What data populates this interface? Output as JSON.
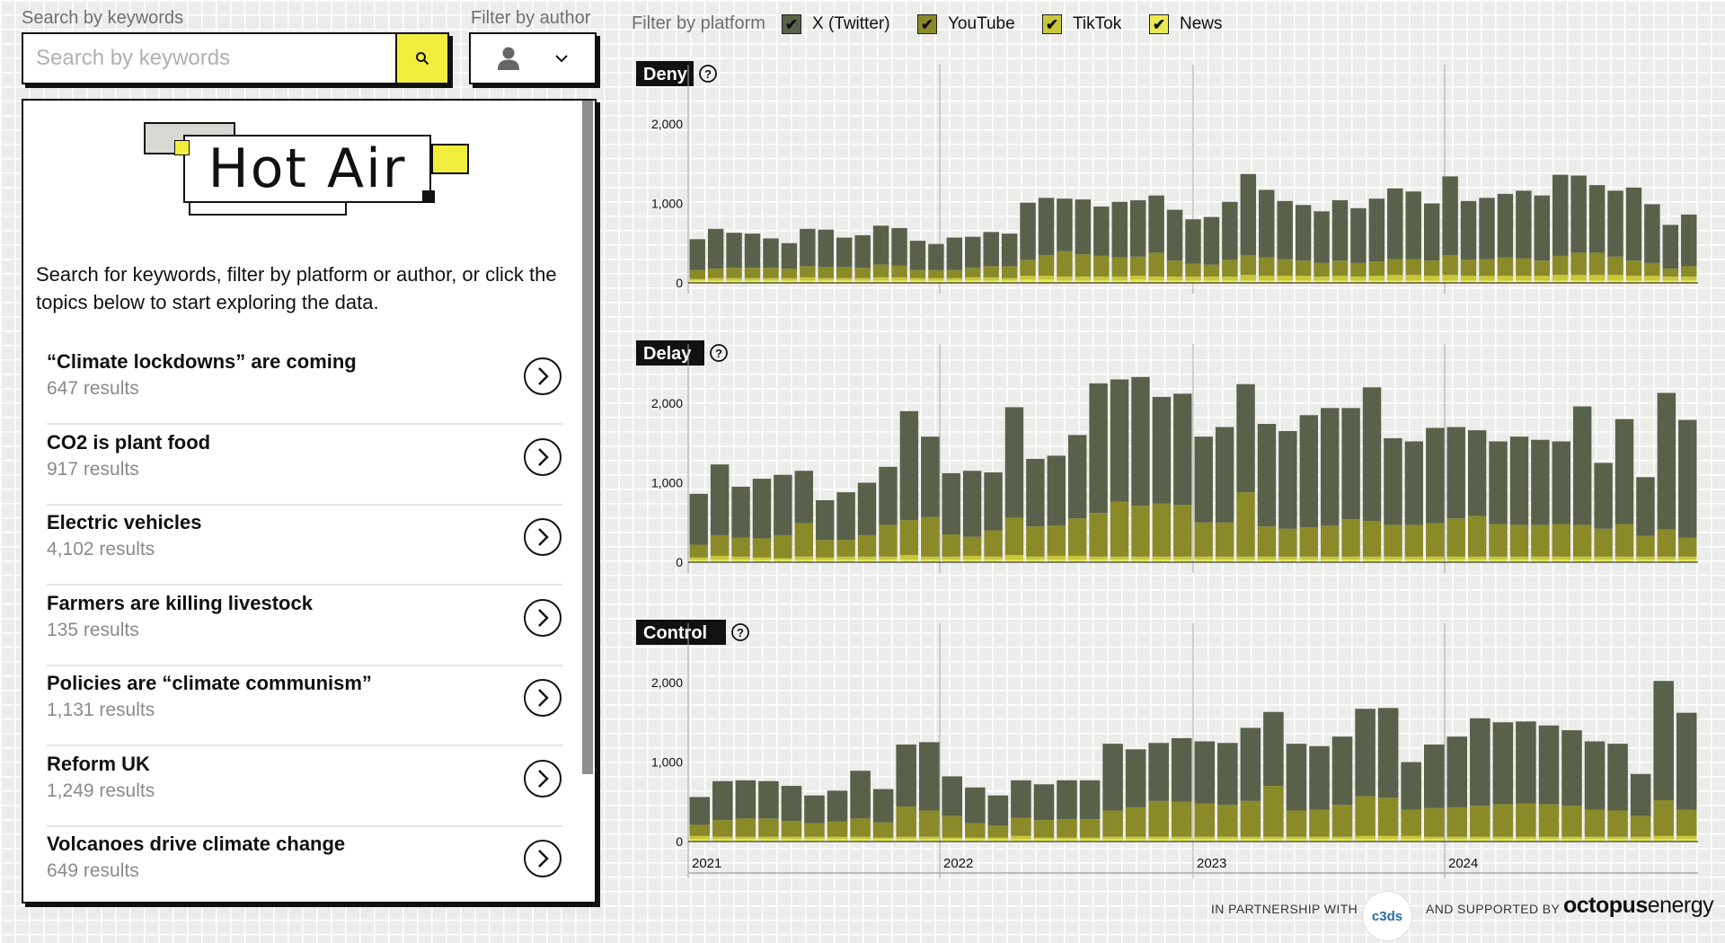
{
  "search": {
    "label": "Search by keywords",
    "placeholder": "Search by keywords"
  },
  "author_filter": {
    "label": "Filter by author"
  },
  "platform_filter": {
    "label": "Filter by platform",
    "options": [
      {
        "label": "X (Twitter)",
        "checked": true,
        "color": "#59614a"
      },
      {
        "label": "YouTube",
        "checked": true,
        "color": "#8a8a29"
      },
      {
        "label": "TikTok",
        "checked": true,
        "color": "#c9c73a"
      },
      {
        "label": "News",
        "checked": true,
        "color": "#ebea55"
      }
    ]
  },
  "logo": {
    "text": "Hot Air"
  },
  "intro": "Search for keywords, filter by platform or author, or click the topics below to start exploring the data.",
  "topics": [
    {
      "title": "“Climate lockdowns” are coming",
      "count": "647 results"
    },
    {
      "title": "CO2 is plant food",
      "count": "917 results"
    },
    {
      "title": "Electric vehicles",
      "count": "4,102 results"
    },
    {
      "title": "Farmers are killing livestock",
      "count": "135 results"
    },
    {
      "title": "Policies are “climate communism”",
      "count": "1,131 results"
    },
    {
      "title": "Reform UK",
      "count": "1,249 results"
    },
    {
      "title": "Volcanoes drive climate change",
      "count": "649 results"
    }
  ],
  "footer": {
    "partnership": "IN PARTNERSHIP WITH",
    "supported": "AND SUPPORTED BY",
    "partner_logo": "c3ds",
    "sponsor": "octopus",
    "sponsor_suffix": "energy"
  },
  "chart_data": {
    "type": "bar",
    "stacked": true,
    "x_ticks": [
      "2021",
      "2022",
      "2023",
      "2024"
    ],
    "x_start": "2021-01",
    "y_ticks": [
      "0",
      "1,000",
      "2,000"
    ],
    "ylim": [
      0,
      2400
    ],
    "series_colors": {
      "X (Twitter)": "#59614a",
      "YouTube": "#8a8a29",
      "TikTok": "#c9c73a",
      "News": "#ebea55"
    },
    "charts": [
      {
        "title": "Deny",
        "total": [
          550,
          680,
          630,
          620,
          560,
          500,
          680,
          670,
          570,
          600,
          720,
          690,
          530,
          490,
          570,
          580,
          640,
          620,
          1010,
          1070,
          1060,
          1050,
          960,
          1020,
          1040,
          1100,
          920,
          800,
          830,
          1020,
          1370,
          1170,
          1030,
          980,
          900,
          1040,
          940,
          1060,
          1190,
          1150,
          1000,
          1340,
          1030,
          1070,
          1120,
          1160,
          1100,
          1360,
          1350,
          1230,
          1160,
          1200,
          990,
          730,
          860
        ],
        "x_twitter": [
          390,
          500,
          440,
          430,
          370,
          320,
          470,
          470,
          370,
          410,
          490,
          470,
          370,
          330,
          410,
          390,
          430,
          410,
          720,
          720,
          660,
          690,
          620,
          700,
          710,
          720,
          640,
          560,
          600,
          730,
          1020,
          850,
          730,
          700,
          650,
          760,
          690,
          790,
          890,
          850,
          720,
          990,
          740,
          770,
          800,
          850,
          820,
          1020,
          970,
          850,
          830,
          920,
          740,
          550,
          650
        ],
        "youtube": [
          110,
          120,
          130,
          130,
          130,
          120,
          140,
          140,
          140,
          130,
          160,
          150,
          100,
          100,
          100,
          120,
          140,
          150,
          200,
          260,
          320,
          280,
          260,
          240,
          240,
          300,
          200,
          160,
          150,
          210,
          250,
          230,
          210,
          190,
          170,
          190,
          170,
          180,
          200,
          200,
          190,
          250,
          200,
          210,
          230,
          220,
          190,
          240,
          280,
          280,
          230,
          190,
          160,
          100,
          130
        ],
        "tiktok": [
          20,
          30,
          30,
          30,
          30,
          30,
          40,
          30,
          30,
          30,
          40,
          40,
          30,
          30,
          30,
          40,
          40,
          30,
          50,
          50,
          50,
          50,
          50,
          50,
          50,
          50,
          50,
          50,
          50,
          50,
          70,
          60,
          60,
          60,
          50,
          60,
          50,
          60,
          70,
          70,
          60,
          70,
          60,
          60,
          60,
          60,
          60,
          70,
          70,
          70,
          70,
          60,
          60,
          50,
          50
        ],
        "news": [
          30,
          30,
          30,
          30,
          30,
          30,
          30,
          30,
          30,
          30,
          30,
          30,
          30,
          30,
          30,
          30,
          30,
          30,
          40,
          40,
          30,
          30,
          30,
          30,
          40,
          30,
          30,
          30,
          30,
          30,
          30,
          30,
          30,
          30,
          30,
          30,
          30,
          30,
          30,
          30,
          30,
          30,
          30,
          30,
          30,
          30,
          30,
          30,
          30,
          30,
          30,
          30,
          30,
          30,
          30
        ]
      },
      {
        "title": "Delay",
        "total": [
          860,
          1230,
          950,
          1050,
          1100,
          1150,
          780,
          880,
          1000,
          1200,
          1900,
          1580,
          1120,
          1150,
          1130,
          1950,
          1300,
          1340,
          1600,
          2250,
          2300,
          2330,
          2080,
          2120,
          1580,
          1700,
          2240,
          1740,
          1650,
          1850,
          1940,
          1940,
          2200,
          1560,
          1520,
          1690,
          1700,
          1660,
          1520,
          1580,
          1540,
          1520,
          1960,
          1240,
          1800,
          1060,
          2130,
          1780
        ],
        "x_twitter": [
          640,
          890,
          640,
          750,
          760,
          660,
          500,
          600,
          660,
          730,
          1370,
          1010,
          770,
          830,
          730,
          1390,
          850,
          880,
          1050,
          1630,
          1540,
          1620,
          1340,
          1400,
          1080,
          1200,
          1360,
          1290,
          1230,
          1410,
          1480,
          1400,
          1680,
          1090,
          1050,
          1200,
          1150,
          1080,
          1040,
          1110,
          1070,
          1040,
          1490,
          830,
          1320,
          740,
          1720,
          1480
        ],
        "youtube": [
          160,
          260,
          240,
          240,
          290,
          420,
          220,
          210,
          270,
          400,
          440,
          500,
          280,
          240,
          330,
          470,
          380,
          380,
          470,
          550,
          690,
          640,
          670,
          650,
          430,
          430,
          810,
          380,
          350,
          370,
          390,
          470,
          450,
          400,
          400,
          420,
          480,
          510,
          410,
          400,
          400,
          410,
          400,
          350,
          410,
          260,
          340,
          240
        ],
        "tiktok": [
          30,
          50,
          40,
          30,
          20,
          40,
          30,
          40,
          40,
          40,
          60,
          40,
          40,
          50,
          40,
          60,
          40,
          50,
          50,
          40,
          40,
          40,
          40,
          40,
          40,
          40,
          40,
          40,
          40,
          40,
          40,
          40,
          40,
          40,
          40,
          40,
          40,
          40,
          40,
          40,
          40,
          40,
          40,
          40,
          40,
          40,
          40,
          40
        ],
        "news": [
          30,
          30,
          30,
          30,
          30,
          30,
          30,
          30,
          30,
          30,
          30,
          30,
          30,
          30,
          30,
          30,
          30,
          30,
          30,
          30,
          30,
          30,
          30,
          30,
          30,
          30,
          30,
          30,
          30,
          30,
          30,
          30,
          30,
          30,
          30,
          30,
          30,
          30,
          30,
          30,
          30,
          30,
          30,
          30,
          30,
          30,
          30,
          30
        ]
      },
      {
        "title": "Control",
        "total": [
          560,
          760,
          770,
          760,
          700,
          580,
          640,
          890,
          660,
          1220,
          1250,
          820,
          680,
          580,
          770,
          720,
          770,
          770,
          1230,
          1160,
          1240,
          1300,
          1260,
          1240,
          1430,
          1630,
          1230,
          1200,
          1320,
          1670,
          1680,
          1000,
          1220,
          1320,
          1550,
          1500,
          1510,
          1460,
          1400,
          1260,
          1230,
          850,
          2020,
          1620
        ],
        "x_twitter": [
          350,
          490,
          480,
          470,
          440,
          350,
          390,
          600,
          420,
          780,
          860,
          500,
          450,
          380,
          470,
          450,
          490,
          490,
          840,
          730,
          730,
          800,
          780,
          780,
          920,
          930,
          840,
          800,
          860,
          1100,
          1130,
          600,
          800,
          890,
          1100,
          1030,
          1030,
          990,
          950,
          860,
          840,
          530,
          1500,
          1220
        ],
        "youtube": [
          140,
          210,
          230,
          230,
          200,
          170,
          190,
          230,
          190,
          380,
          330,
          270,
          180,
          150,
          230,
          220,
          230,
          230,
          330,
          370,
          450,
          440,
          420,
          400,
          450,
          640,
          330,
          340,
          400,
          500,
          480,
          330,
          360,
          370,
          390,
          410,
          420,
          410,
          390,
          340,
          330,
          260,
          450,
          330
        ],
        "tiktok": [
          40,
          30,
          30,
          30,
          30,
          30,
          30,
          30,
          20,
          30,
          30,
          20,
          20,
          20,
          40,
          20,
          20,
          20,
          30,
          30,
          30,
          30,
          30,
          30,
          30,
          30,
          30,
          30,
          30,
          40,
          40,
          40,
          30,
          30,
          30,
          30,
          30,
          30,
          30,
          30,
          30,
          30,
          40,
          40
        ],
        "news": [
          30,
          30,
          30,
          30,
          30,
          30,
          30,
          30,
          30,
          30,
          30,
          30,
          30,
          30,
          30,
          30,
          30,
          30,
          30,
          30,
          30,
          30,
          30,
          30,
          30,
          30,
          30,
          30,
          30,
          30,
          30,
          30,
          30,
          30,
          30,
          30,
          30,
          30,
          30,
          30,
          30,
          30,
          30,
          30
        ]
      }
    ]
  }
}
